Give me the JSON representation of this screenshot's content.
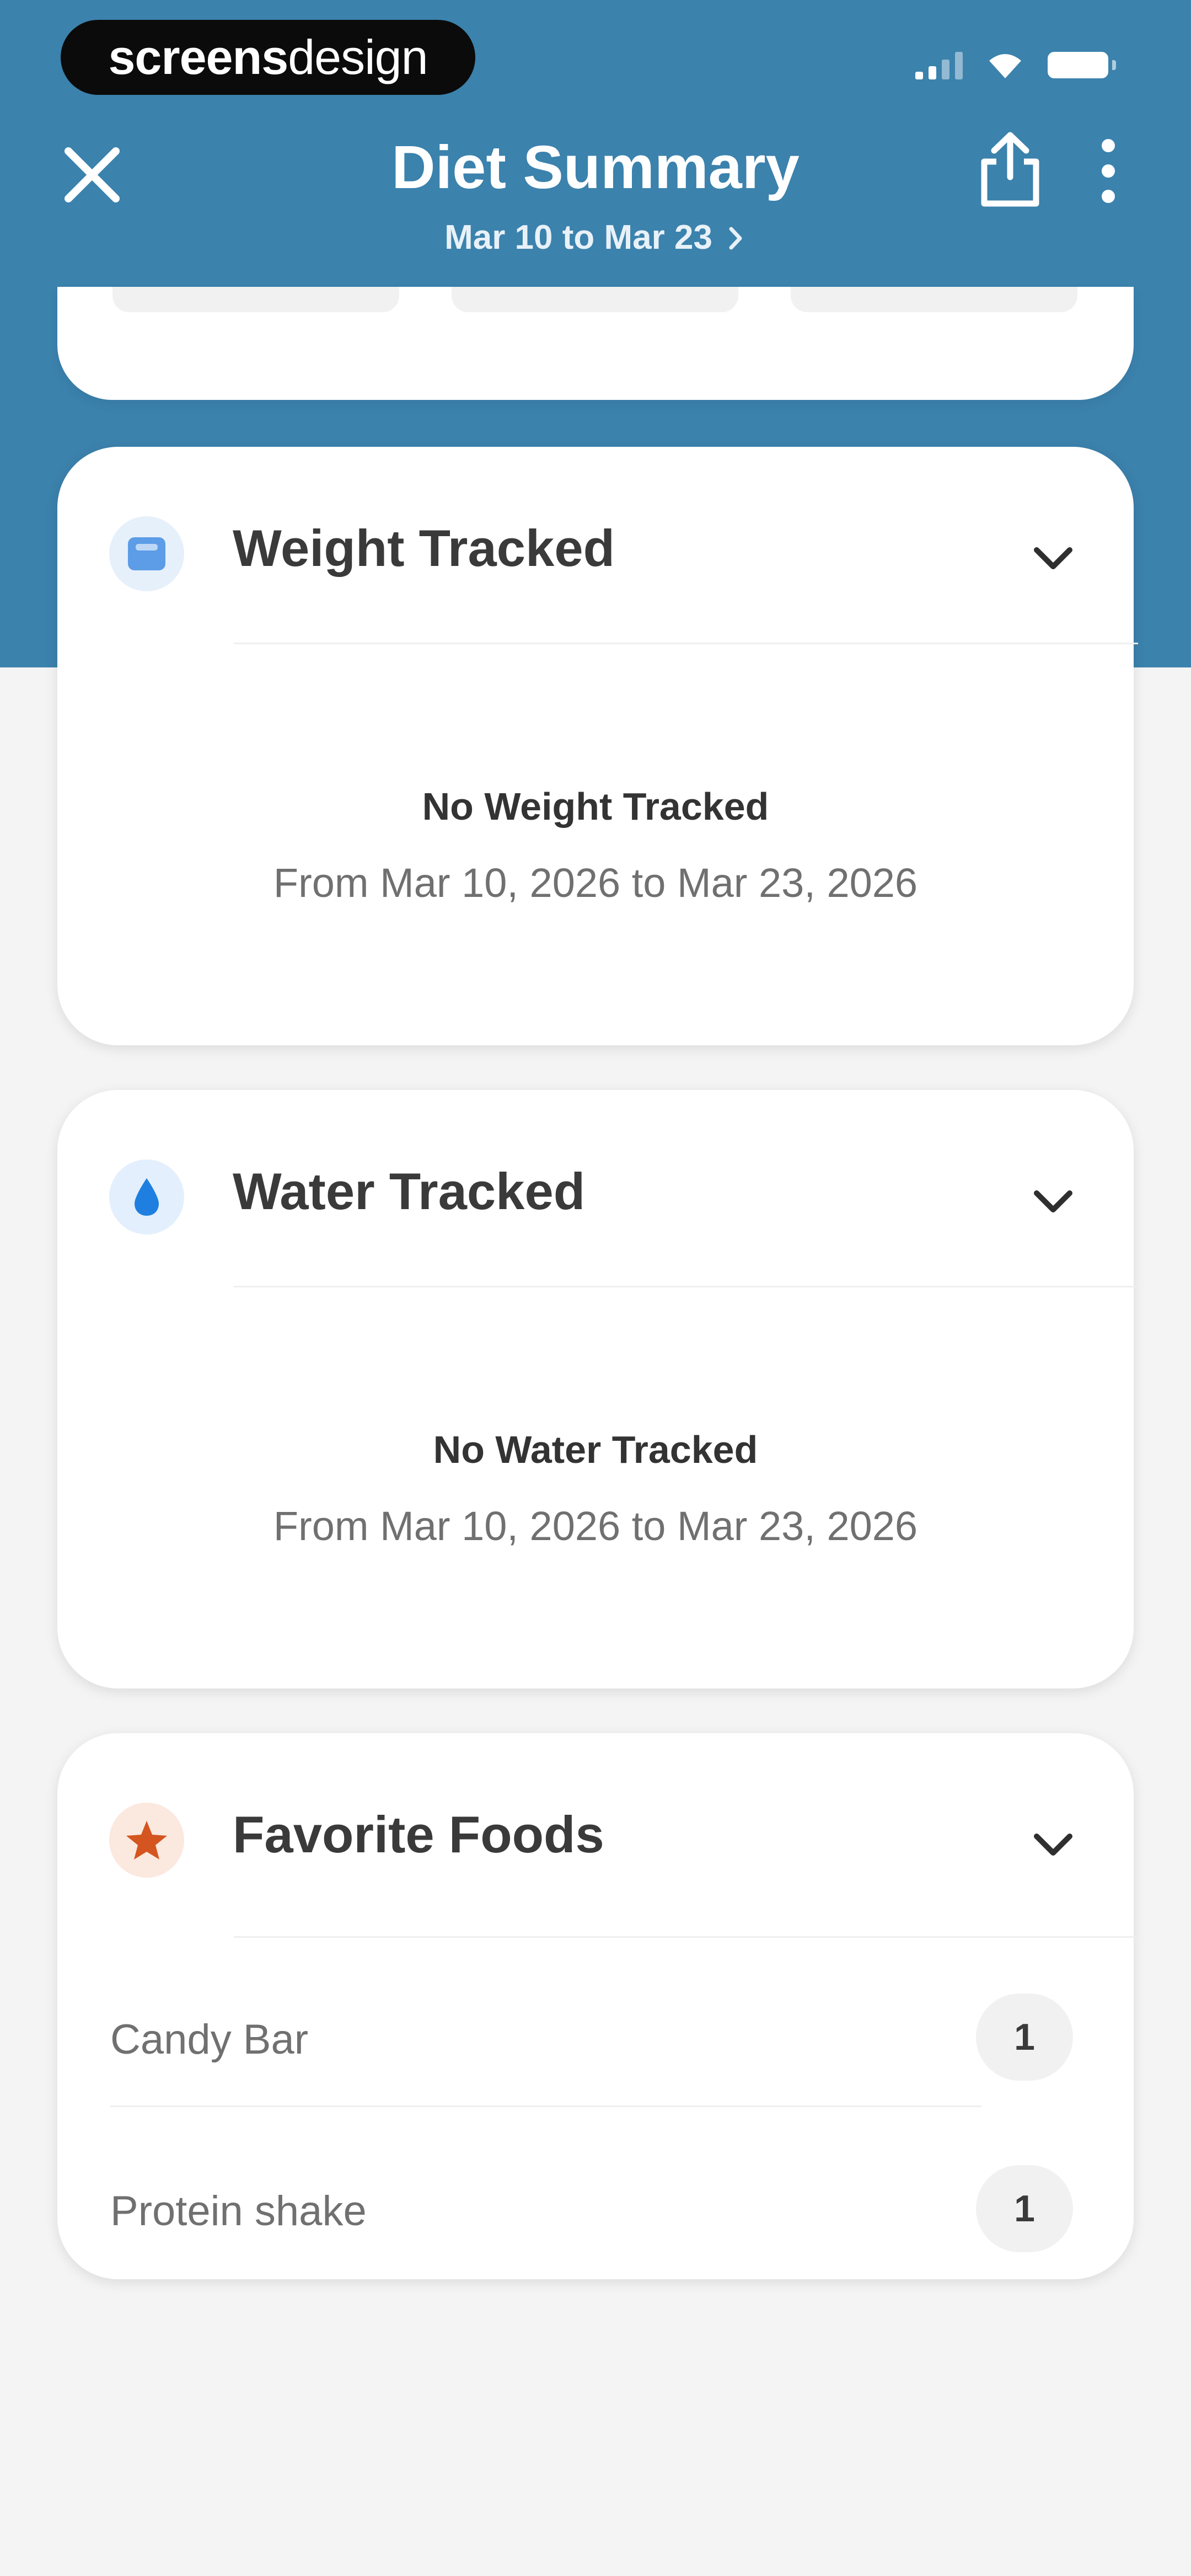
{
  "watermark": {
    "part1": "screens",
    "part2": "design"
  },
  "header": {
    "title": "Diet Summary",
    "subtitle": "Mar 10 to Mar 23"
  },
  "sections": {
    "weight": {
      "title": "Weight Tracked",
      "empty_title": "No Weight Tracked",
      "empty_subtitle": "From Mar 10, 2026 to Mar 23, 2026"
    },
    "water": {
      "title": "Water Tracked",
      "empty_title": "No Water Tracked",
      "empty_subtitle": "From Mar 10, 2026 to Mar 23, 2026"
    },
    "favorites": {
      "title": "Favorite Foods",
      "items": [
        {
          "name": "Candy Bar",
          "count": "1"
        },
        {
          "name": "Protein shake",
          "count": "1"
        }
      ]
    }
  },
  "icons": {
    "close": "close-icon",
    "share": "share-icon",
    "more": "more-vertical-icon",
    "weight": "scale-icon",
    "water": "water-drop-icon",
    "favorites": "star-icon",
    "expand": "chevron-down-icon"
  },
  "colors": {
    "header_bg": "#3b82ad",
    "page_bg": "#f4f4f4",
    "weight_icon": "#5d9ce6",
    "water_icon": "#1e7fe0",
    "star_icon": "#d4551f"
  }
}
